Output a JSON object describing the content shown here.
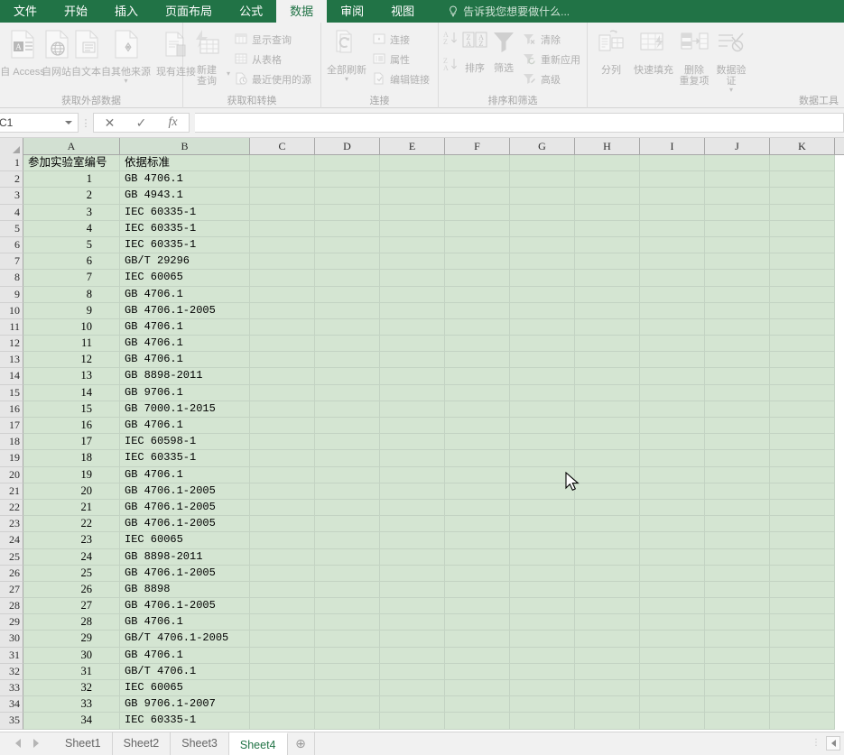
{
  "window": {
    "app": "Excel"
  },
  "ribbon": {
    "tabs": [
      {
        "label": "文件",
        "active": false
      },
      {
        "label": "开始",
        "active": false
      },
      {
        "label": "插入",
        "active": false
      },
      {
        "label": "页面布局",
        "active": false
      },
      {
        "label": "公式",
        "active": false
      },
      {
        "label": "数据",
        "active": true
      },
      {
        "label": "审阅",
        "active": false
      },
      {
        "label": "视图",
        "active": false
      }
    ],
    "tellme": "告诉我您想要做什么...",
    "groups": [
      {
        "title": "获取外部数据",
        "big": [
          {
            "label": "自 Access",
            "label2": "",
            "icon": "access-icon"
          },
          {
            "label": "自网站",
            "label2": "",
            "icon": "web-icon"
          },
          {
            "label": "自文本",
            "label2": "",
            "icon": "text-icon"
          },
          {
            "label": "自其他来源",
            "label2": "",
            "icon": "other-sources-icon"
          },
          {
            "label": "现有连接",
            "label2": "",
            "icon": "existing-connections-icon"
          }
        ]
      },
      {
        "title": "获取和转换",
        "big": [
          {
            "label": "新建",
            "label2": "查询",
            "icon": "new-query-icon"
          }
        ],
        "small": [
          {
            "label": "显示查询",
            "icon": "show-queries-icon"
          },
          {
            "label": "从表格",
            "icon": "from-table-icon"
          },
          {
            "label": "最近使用的源",
            "icon": "recent-sources-icon"
          }
        ]
      },
      {
        "title": "连接",
        "big": [
          {
            "label": "全部刷新",
            "label2": "",
            "icon": "refresh-all-icon"
          }
        ],
        "small": [
          {
            "label": "连接",
            "icon": "connections-icon"
          },
          {
            "label": "属性",
            "icon": "properties-icon"
          },
          {
            "label": "编辑链接",
            "icon": "edit-links-icon"
          }
        ]
      },
      {
        "title": "排序和筛选",
        "big": [
          {
            "label": "排序",
            "label2": "",
            "icon": "sort-icon"
          },
          {
            "label": "筛选",
            "label2": "",
            "icon": "filter-icon"
          }
        ],
        "small": [
          {
            "label": "清除",
            "icon": "clear-filter-icon"
          },
          {
            "label": "重新应用",
            "icon": "reapply-icon"
          },
          {
            "label": "高级",
            "icon": "advanced-filter-icon"
          }
        ],
        "sortaz": "A↓Z",
        "sortza": "Z↓A"
      },
      {
        "title": "数据工具",
        "big": [
          {
            "label": "分列",
            "label2": "",
            "icon": "text-to-columns-icon"
          },
          {
            "label": "快速填充",
            "label2": "",
            "icon": "flash-fill-icon"
          },
          {
            "label": "删除",
            "label2": "重复项",
            "icon": "remove-duplicates-icon"
          },
          {
            "label": "数据验",
            "label2": "证",
            "icon": "data-validation-icon"
          }
        ]
      }
    ]
  },
  "formula_bar": {
    "name_box": "C1",
    "cancel": "✕",
    "confirm": "✓",
    "fx": "fx",
    "value": ""
  },
  "grid": {
    "columns": [
      "A",
      "B",
      "C",
      "D",
      "E",
      "F",
      "G",
      "H",
      "I",
      "J",
      "K"
    ],
    "headers": {
      "A": "参加实验室编号",
      "B": "依据标准"
    },
    "rows": [
      {
        "n": "1",
        "a": "参加实验室编号",
        "b": "依据标准"
      },
      {
        "n": "2",
        "a": "1",
        "b": "GB 4706.1"
      },
      {
        "n": "3",
        "a": "2",
        "b": "GB 4943.1"
      },
      {
        "n": "4",
        "a": "3",
        "b": "IEC 60335-1"
      },
      {
        "n": "5",
        "a": "4",
        "b": "IEC 60335-1"
      },
      {
        "n": "6",
        "a": "5",
        "b": "IEC 60335-1"
      },
      {
        "n": "7",
        "a": "6",
        "b": "GB/T 29296"
      },
      {
        "n": "8",
        "a": "7",
        "b": "IEC 60065"
      },
      {
        "n": "9",
        "a": "8",
        "b": "GB 4706.1"
      },
      {
        "n": "10",
        "a": "9",
        "b": "GB 4706.1-2005"
      },
      {
        "n": "11",
        "a": "10",
        "b": "GB 4706.1"
      },
      {
        "n": "12",
        "a": "11",
        "b": "GB 4706.1"
      },
      {
        "n": "13",
        "a": "12",
        "b": "GB 4706.1"
      },
      {
        "n": "14",
        "a": "13",
        "b": "GB 8898-2011"
      },
      {
        "n": "15",
        "a": "14",
        "b": "GB 9706.1"
      },
      {
        "n": "16",
        "a": "15",
        "b": "GB 7000.1-2015"
      },
      {
        "n": "17",
        "a": "16",
        "b": "GB 4706.1"
      },
      {
        "n": "18",
        "a": "17",
        "b": "IEC 60598-1"
      },
      {
        "n": "19",
        "a": "18",
        "b": "IEC 60335-1"
      },
      {
        "n": "20",
        "a": "19",
        "b": "GB 4706.1"
      },
      {
        "n": "21",
        "a": "20",
        "b": "GB 4706.1-2005"
      },
      {
        "n": "22",
        "a": "21",
        "b": "GB 4706.1-2005"
      },
      {
        "n": "23",
        "a": "22",
        "b": "GB 4706.1-2005"
      },
      {
        "n": "24",
        "a": "23",
        "b": "IEC 60065"
      },
      {
        "n": "25",
        "a": "24",
        "b": "GB 8898-2011"
      },
      {
        "n": "26",
        "a": "25",
        "b": "GB 4706.1-2005"
      },
      {
        "n": "27",
        "a": "26",
        "b": "GB 8898"
      },
      {
        "n": "28",
        "a": "27",
        "b": "GB 4706.1-2005"
      },
      {
        "n": "29",
        "a": "28",
        "b": "GB 4706.1"
      },
      {
        "n": "30",
        "a": "29",
        "b": "GB/T 4706.1-2005"
      },
      {
        "n": "31",
        "a": "30",
        "b": "GB 4706.1"
      },
      {
        "n": "32",
        "a": "31",
        "b": "GB/T 4706.1"
      },
      {
        "n": "33",
        "a": "32",
        "b": "IEC 60065"
      },
      {
        "n": "34",
        "a": "33",
        "b": "GB 9706.1-2007"
      },
      {
        "n": "35",
        "a": "34",
        "b": "IEC 60335-1"
      }
    ]
  },
  "sheets": {
    "tabs": [
      {
        "label": "Sheet1",
        "active": false
      },
      {
        "label": "Sheet2",
        "active": false
      },
      {
        "label": "Sheet3",
        "active": false
      },
      {
        "label": "Sheet4",
        "active": true
      }
    ],
    "add_label": "⊕"
  },
  "colors": {
    "ribbon_green": "#217346",
    "selection_fill": "#d4e5d2",
    "grid_line": "#c3d3c3"
  }
}
